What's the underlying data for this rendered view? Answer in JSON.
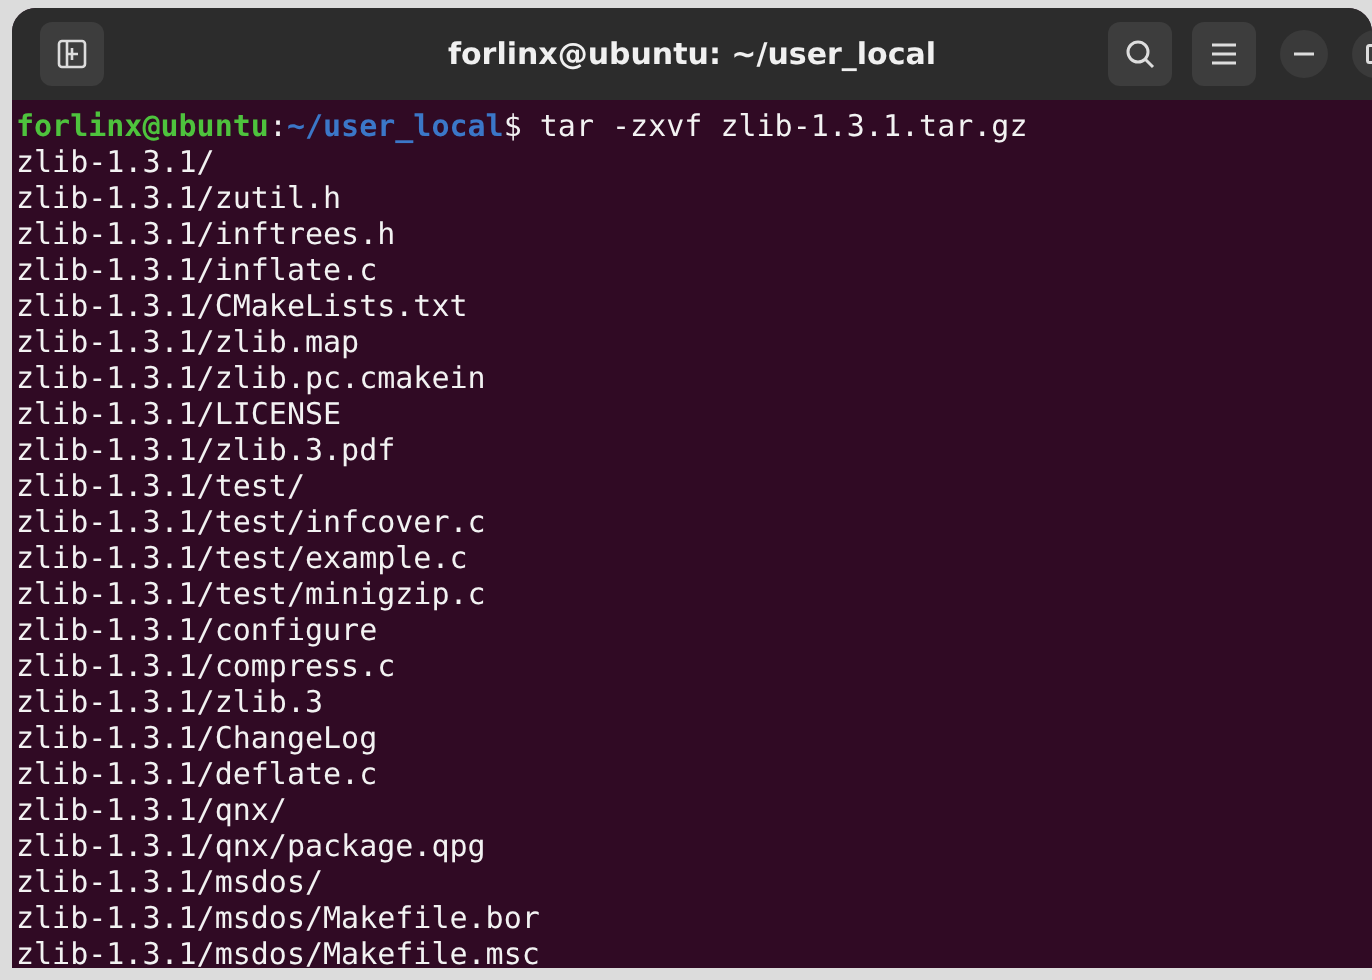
{
  "window": {
    "title": "forlinx@ubuntu: ~/user_local"
  },
  "prompt": {
    "user_host": "forlinx@ubuntu",
    "separator": ":",
    "path": "~/user_local",
    "symbol": "$",
    "command": "tar -zxvf zlib-1.3.1.tar.gz"
  },
  "output_lines": [
    "zlib-1.3.1/",
    "zlib-1.3.1/zutil.h",
    "zlib-1.3.1/inftrees.h",
    "zlib-1.3.1/inflate.c",
    "zlib-1.3.1/CMakeLists.txt",
    "zlib-1.3.1/zlib.map",
    "zlib-1.3.1/zlib.pc.cmakein",
    "zlib-1.3.1/LICENSE",
    "zlib-1.3.1/zlib.3.pdf",
    "zlib-1.3.1/test/",
    "zlib-1.3.1/test/infcover.c",
    "zlib-1.3.1/test/example.c",
    "zlib-1.3.1/test/minigzip.c",
    "zlib-1.3.1/configure",
    "zlib-1.3.1/compress.c",
    "zlib-1.3.1/zlib.3",
    "zlib-1.3.1/ChangeLog",
    "zlib-1.3.1/deflate.c",
    "zlib-1.3.1/qnx/",
    "zlib-1.3.1/qnx/package.qpg",
    "zlib-1.3.1/msdos/",
    "zlib-1.3.1/msdos/Makefile.bor",
    "zlib-1.3.1/msdos/Makefile.msc"
  ]
}
